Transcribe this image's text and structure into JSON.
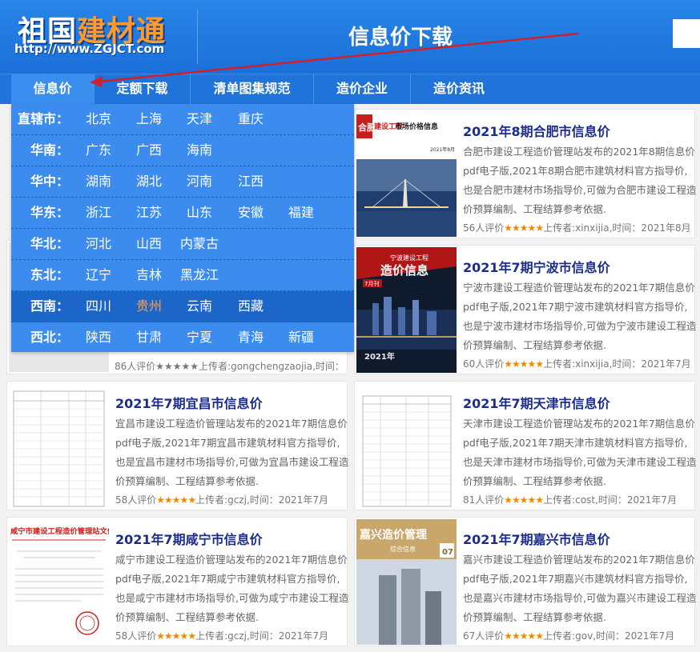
{
  "header": {
    "logo_text_plain": "祖国",
    "logo_text_highlight": "建材通",
    "logo_url": "http://www.ZGJCT.com",
    "title": "信息价下载"
  },
  "nav": {
    "items": [
      {
        "label": "信息价"
      },
      {
        "label": "定额下载"
      },
      {
        "label": "清单图集规范"
      },
      {
        "label": "造价企业"
      },
      {
        "label": "造价资讯"
      }
    ]
  },
  "dropdown": {
    "rows": [
      {
        "region": "直辖市：",
        "cities": [
          "北京",
          "上海",
          "天津",
          "重庆"
        ]
      },
      {
        "region": "华南：",
        "cities": [
          "广东",
          "广西",
          "海南"
        ]
      },
      {
        "region": "华中：",
        "cities": [
          "湖南",
          "湖北",
          "河南",
          "江西"
        ]
      },
      {
        "region": "华东：",
        "cities": [
          "浙江",
          "江苏",
          "山东",
          "安徽",
          "福建"
        ]
      },
      {
        "region": "华北：",
        "cities": [
          "河北",
          "山西",
          "内蒙古"
        ]
      },
      {
        "region": "东北：",
        "cities": [
          "辽宁",
          "吉林",
          "黑龙江"
        ]
      },
      {
        "region": "西南：",
        "cities": [
          "四川",
          "贵州",
          "云南",
          "西藏"
        ]
      },
      {
        "region": "西北：",
        "cities": [
          "陕西",
          "甘肃",
          "宁夏",
          "青海",
          "新疆"
        ]
      }
    ],
    "highlight_city": "贵州"
  },
  "hidden_card": {
    "footer": "86人评价★★★★★上传者:gongchengzaojia,时间："
  },
  "cards": [
    {
      "title": "2021年8期合肥市信息价",
      "desc": "合肥市建设工程造价管理站发布的2021年8期信息价pdf电子版,2021年8期合肥市建筑材料官方指导价,也是合肥市建材市场指导价,可做为合肥市建设工程造价预算编制、工程结算参考依据.",
      "count": "56人评价",
      "stars": "★★★★★",
      "meta": "上传者:xinxijia,时间：2021年8月",
      "thumb_title_a": "合肥",
      "thumb_title_b": "建设工程",
      "thumb_title_c": "市场价格信息",
      "thumb_date": "2021年8月"
    },
    {
      "title": "2021年7期宁波市信息价",
      "desc": "宁波市建设工程造价管理站发布的2021年7期信息价pdf电子版,2021年7期宁波市建筑材料官方指导价,也是宁波市建材市场指导价,可做为宁波市建设工程造价预算编制、工程结算参考依据.",
      "count": "60人评价",
      "stars": "★★★★★",
      "meta": "上传者:xinxijia,时间：2021年7月",
      "thumb_title_a": "宁波建设工程",
      "thumb_title_b": "造价信息",
      "thumb_title_c": "7月刊",
      "thumb_date": "2021年"
    },
    {
      "title": "2021年7期宜昌市信息价",
      "desc": "宜昌市建设工程造价管理站发布的2021年7期信息价pdf电子版,2021年7期宜昌市建筑材料官方指导价,也是宜昌市建材市场指导价,可做为宜昌市建设工程造价预算编制、工程结算参考依据.",
      "count": "58人评价",
      "stars": "★★★★★",
      "meta": "上传者:gczj,时间：2021年7月"
    },
    {
      "title": "2021年7期天津市信息价",
      "desc": "天津市建设工程造价管理站发布的2021年7期信息价pdf电子版,2021年7期天津市建筑材料官方指导价,也是天津市建材市场指导价,可做为天津市建设工程造价预算编制、工程结算参考依据.",
      "count": "81人评价",
      "stars": "★★★★★",
      "meta": "上传者:cost,时间：2021年7月"
    },
    {
      "title": "2021年7期咸宁市信息价",
      "desc": "咸宁市建设工程造价管理站发布的2021年7期信息价pdf电子版,2021年7期咸宁市建筑材料官方指导价,也是咸宁市建材市场指导价,可做为咸宁市建设工程造价预算编制、工程结算参考依据.",
      "count": "58人评价",
      "stars": "★★★★★",
      "meta": "上传者:gczj,时间：2021年7月",
      "thumb_title_a": "咸宁市建设工程造价管理站文件"
    },
    {
      "title": "2021年7期嘉兴市信息价",
      "desc": "嘉兴市建设工程造价管理站发布的2021年7期信息价pdf电子版,2021年7期嘉兴市建筑材料官方指导价,也是嘉兴市建材市场指导价,可做为嘉兴市建设工程造价预算编制、工程结算参考依据.",
      "count": "67人评价",
      "stars": "★★★★★",
      "meta": "上传者:gov,时间：2021年7月",
      "thumb_title_a": "嘉兴造价管理",
      "thumb_title_b": "综合信息",
      "thumb_date": "07"
    }
  ],
  "colors": {
    "header_blue": "#1f73d9",
    "dropdown_blue": "#3c8cf0",
    "title_navy": "#1b2c8a",
    "star_orange": "#f08a00",
    "highlight_orange": "#ffa143",
    "arrow_red": "#d0202a"
  }
}
